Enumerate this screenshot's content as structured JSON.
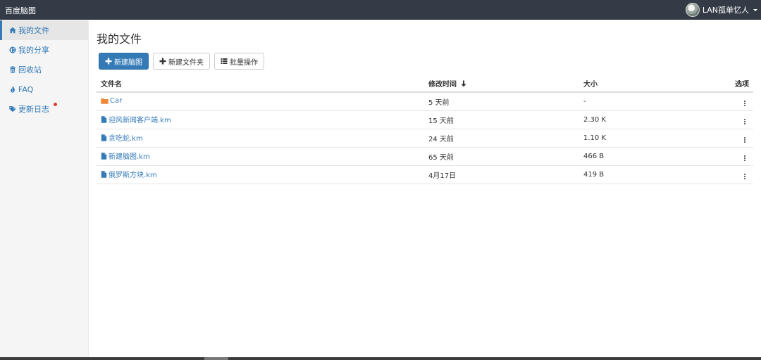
{
  "app": {
    "title": "百度脑图"
  },
  "user": {
    "name": "LAN孤单忆人"
  },
  "sidebar": {
    "items": [
      {
        "label": "我的文件",
        "icon": "home-icon"
      },
      {
        "label": "我的分享",
        "icon": "globe-icon"
      },
      {
        "label": "回收站",
        "icon": "trash-icon"
      },
      {
        "label": "FAQ",
        "icon": "fire-icon"
      },
      {
        "label": "更新日志",
        "icon": "tags-icon"
      }
    ],
    "active_index": 0
  },
  "main": {
    "title": "我的文件",
    "toolbar": {
      "new_map": "新建脑图",
      "new_folder": "新建文件夹",
      "batch": "批量操作"
    },
    "table": {
      "headers": {
        "name": "文件名",
        "time": "修改时间",
        "size": "大小",
        "options": "选项"
      },
      "rows": [
        {
          "name": "Car",
          "type": "folder",
          "time": "5 天前",
          "size": "-"
        },
        {
          "name": "迎风新闻客户端.km",
          "type": "file",
          "time": "15 天前",
          "size": "2.30 K"
        },
        {
          "name": "贪吃蛇.km",
          "type": "file",
          "time": "24 天前",
          "size": "1.10 K"
        },
        {
          "name": "新建脑图.km",
          "type": "file",
          "time": "65 天前",
          "size": "466 B"
        },
        {
          "name": "俄罗斯方块.km",
          "type": "file",
          "time": "4月17日",
          "size": "419 B"
        }
      ]
    }
  },
  "colors": {
    "navbar": "#343a46",
    "link": "#337ab7",
    "primary_button": "#337ab7",
    "folder": "#f0883a",
    "badge_dot": "#e23b2e"
  }
}
